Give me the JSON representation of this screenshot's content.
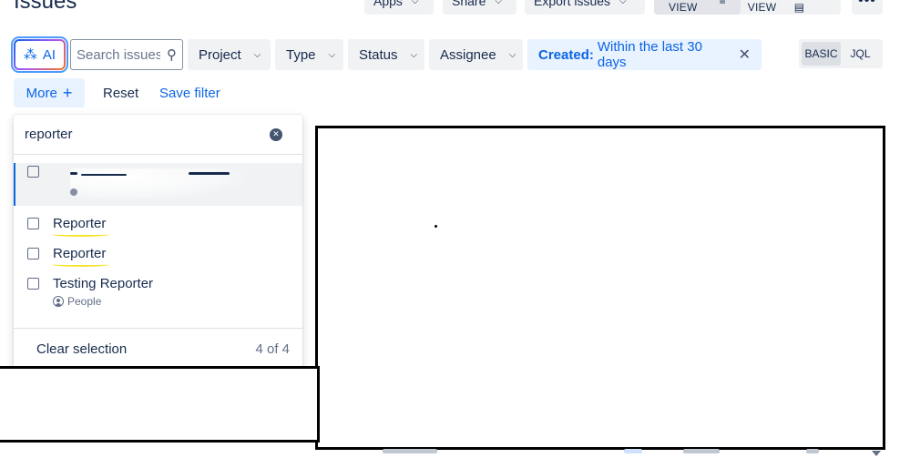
{
  "header": {
    "title": "Issues",
    "apps_label": "Apps",
    "share_label": "Share",
    "export_label": "Export issues",
    "list_view_label": "LIST VIEW",
    "detail_view_label": "DETAIL VIEW",
    "more_label": "•••"
  },
  "filters": {
    "ai_label": "AI",
    "search_placeholder": "Search issues",
    "chips": {
      "project": "Project",
      "type": "Type",
      "status": "Status",
      "assignee": "Assignee"
    },
    "created": {
      "prefix": "Created:",
      "value": "Within the last 30 days"
    },
    "mode": {
      "basic": "BASIC",
      "jql": "JQL",
      "selected": "BASIC"
    }
  },
  "actions": {
    "more_label": "More",
    "reset_label": "Reset",
    "save_label": "Save filter"
  },
  "dropdown": {
    "search_value": "reporter",
    "items": [
      {
        "label": "",
        "sub": "",
        "redacted": true
      },
      {
        "label": "Reporter",
        "sub": ""
      },
      {
        "label": "Reporter",
        "sub": ""
      },
      {
        "label": "Testing Reporter",
        "sub": "People"
      }
    ],
    "clear_label": "Clear selection",
    "count_label": "4 of 4"
  },
  "colors": {
    "accent": "#0c66e4",
    "text": "#172b4d",
    "chip_bg": "#f1f2f4",
    "active_chip_bg": "#e9f2ff",
    "highlight_underline": "#f5e42a"
  }
}
